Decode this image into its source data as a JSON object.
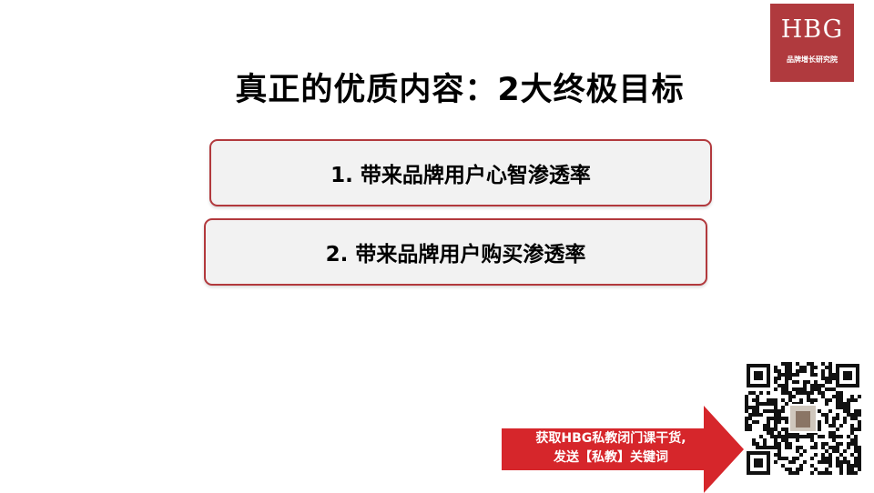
{
  "logo": {
    "mark": "HBG",
    "subtitle": "品牌增长研究院"
  },
  "slide": {
    "title": "真正的优质内容：2大终极目标",
    "goals": [
      {
        "label": "1. 带来品牌用户心智渗透率"
      },
      {
        "label": "2. 带来品牌用户购买渗透率"
      }
    ]
  },
  "cta": {
    "line1": "获取HBG私教闭门课干货,",
    "line2": "发送【私教】关键词"
  },
  "colors": {
    "brand": "#b03a3e",
    "arrow": "#d6262b",
    "box_border": "#b2393d",
    "box_fill": "#f2f2f2"
  },
  "icons": {
    "qr": "qr-code-icon"
  }
}
